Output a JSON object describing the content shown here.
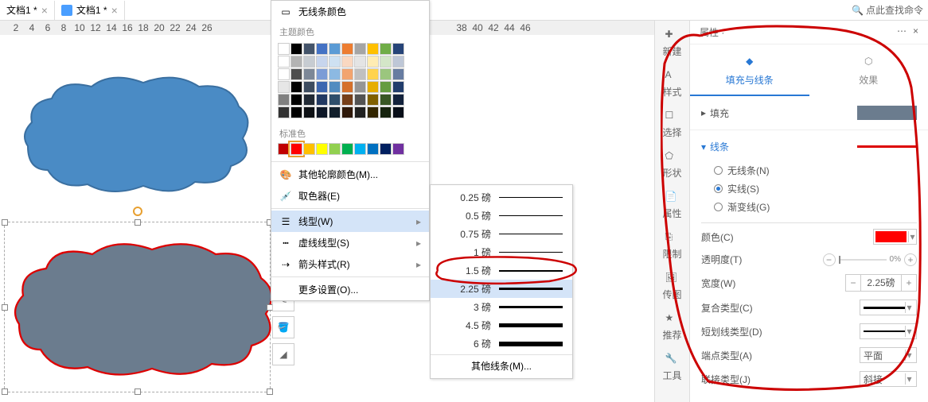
{
  "tabs": [
    {
      "label": "文档1 *"
    },
    {
      "label": "文档1 *"
    }
  ],
  "help_text": "点此查找命令",
  "ruler_left": [
    "2",
    "4",
    "6",
    "8",
    "10",
    "12",
    "14",
    "16",
    "18",
    "20",
    "22",
    "24",
    "26"
  ],
  "ruler_right": [
    "38",
    "40",
    "42",
    "44",
    "46"
  ],
  "popup": {
    "no_outline": "无线条颜色",
    "theme_label": "主题颜色",
    "standard_label": "标准色",
    "theme_base": [
      "#ffffff",
      "#000000",
      "#44546a",
      "#4472c4",
      "#5b9bd5",
      "#ed7d31",
      "#a5a5a5",
      "#ffc000",
      "#70ad47",
      "#264478"
    ],
    "standard": [
      "#c00000",
      "#ff0000",
      "#ffc000",
      "#ffff00",
      "#92d050",
      "#00b050",
      "#00b0f0",
      "#0070c0",
      "#002060",
      "#7030a0"
    ],
    "selected_std": 1,
    "other_colors": "其他轮廓颜色(M)...",
    "picker": "取色器(E)",
    "line_width": "线型(W)",
    "dash_style": "虚线线型(S)",
    "arrow_style": "箭头样式(R)",
    "more_settings": "更多设置(O)..."
  },
  "widths": [
    {
      "label": "0.25 磅",
      "h": 0.5
    },
    {
      "label": "0.5 磅",
      "h": 0.75
    },
    {
      "label": "0.75 磅",
      "h": 1
    },
    {
      "label": "1 磅",
      "h": 1.5
    },
    {
      "label": "1.5 磅",
      "h": 2
    },
    {
      "label": "2.25 磅",
      "h": 2.5,
      "selected": true
    },
    {
      "label": "3 磅",
      "h": 3
    },
    {
      "label": "4.5 磅",
      "h": 4.5
    },
    {
      "label": "6 磅",
      "h": 6
    }
  ],
  "widths_other": "其他线条(M)...",
  "sidenav": [
    "新建",
    "样式",
    "选择",
    "形状",
    "属性",
    "限制",
    "传图",
    "推荐",
    "工具"
  ],
  "panel": {
    "title": "属性 ·",
    "tab_fill": "填充与线条",
    "tab_effect": "效果",
    "fill_section": "填充",
    "line_section": "线条",
    "no_line": "无线条(N)",
    "solid_line": "实线(S)",
    "gradient_line": "渐变线(G)",
    "color_label": "颜色(C)",
    "color_value": "#ff0000",
    "opacity_label": "透明度(T)",
    "opacity_value": "0%",
    "width_label": "宽度(W)",
    "width_value": "2.25磅",
    "compound_label": "复合类型(C)",
    "dash_label": "短划线类型(D)",
    "cap_label": "端点类型(A)",
    "cap_value": "平面",
    "join_label": "联接类型(J)",
    "join_value": "斜接"
  }
}
